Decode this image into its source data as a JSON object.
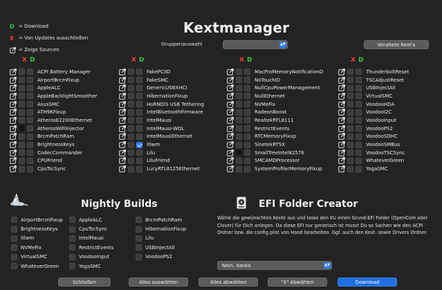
{
  "legend": {
    "download_key": "D",
    "download_text": "= Download",
    "exclude_key": "X",
    "exclude_text": "= Von Updates ausschließen",
    "source_text": "= Zeige Sourcen",
    "source_icon": "edit-external-icon"
  },
  "title": "Kextmanager",
  "group": {
    "label": "Gruppenauswahl",
    "value": ""
  },
  "outdated_button": "Veraltete Kext's",
  "column_header": {
    "x": "X",
    "d": "D"
  },
  "columns": [
    {
      "items": [
        {
          "name": "ACPI Battery Manager",
          "d": false,
          "dark": false
        },
        {
          "name": "AirportBrcmFixup",
          "d": false,
          "dark": false
        },
        {
          "name": "AppleALC",
          "d": false,
          "dark": false
        },
        {
          "name": "AppleBacklightSmoother",
          "d": false,
          "dark": false
        },
        {
          "name": "AsusSMC",
          "d": false,
          "dark": false
        },
        {
          "name": "ATH9KFixup",
          "d": false,
          "dark": false
        },
        {
          "name": "AtherosE2200Ethernet",
          "d": false,
          "dark": false
        },
        {
          "name": "AtherosWiFiInjector",
          "d": false,
          "dark": true
        },
        {
          "name": "BrcmPatchRam",
          "d": false,
          "dark": false
        },
        {
          "name": "BrightnessKeys",
          "d": false,
          "dark": false
        },
        {
          "name": "CodecCommander",
          "d": false,
          "dark": false
        },
        {
          "name": "CPUFriend",
          "d": false,
          "dark": false
        },
        {
          "name": "CpuTscSync",
          "d": false,
          "dark": false
        }
      ]
    },
    {
      "items": [
        {
          "name": "FakePCIID",
          "d": false,
          "dark": false
        },
        {
          "name": "FakeSMC",
          "d": false,
          "dark": false
        },
        {
          "name": "GenericUSBXHCI",
          "d": false,
          "dark": false
        },
        {
          "name": "HibernationFixup",
          "d": false,
          "dark": false
        },
        {
          "name": "HoRNDIS USB Tethering",
          "d": false,
          "dark": false
        },
        {
          "name": "IntelBluetoothFirmware",
          "d": false,
          "dark": false
        },
        {
          "name": "IntelMausi",
          "d": false,
          "dark": false
        },
        {
          "name": "IntelMausi-WOL",
          "d": false,
          "dark": false
        },
        {
          "name": "IntelMausiEthernet",
          "d": false,
          "dark": false
        },
        {
          "name": "itlwm",
          "d": true,
          "dark": false
        },
        {
          "name": "Lilu",
          "d": false,
          "dark": false
        },
        {
          "name": "LiluFriend",
          "d": false,
          "dark": false
        },
        {
          "name": "LucyRTL8125Ethernet",
          "d": false,
          "dark": false
        }
      ]
    },
    {
      "items": [
        {
          "name": "MacProMemoryNotificationD",
          "d": false,
          "dark": false
        },
        {
          "name": "NoTouchID",
          "d": false,
          "dark": false
        },
        {
          "name": "NullCpuPowerManagement",
          "d": false,
          "dark": false
        },
        {
          "name": "NullEthernet",
          "d": false,
          "dark": false
        },
        {
          "name": "NVMeFix",
          "d": false,
          "dark": false
        },
        {
          "name": "RadeonBoost",
          "d": false,
          "dark": false
        },
        {
          "name": "RealtekRTL8111",
          "d": false,
          "dark": false
        },
        {
          "name": "RestrictEvents",
          "d": false,
          "dark": false
        },
        {
          "name": "RTCMemoryFixup",
          "d": false,
          "dark": false
        },
        {
          "name": "SinetekRTSX",
          "d": false,
          "dark": false
        },
        {
          "name": "SmallTreeIntel82576",
          "d": false,
          "dark": true
        },
        {
          "name": "SMCAMDProcessor",
          "d": false,
          "dark": false
        },
        {
          "name": "SystemProfilerMemoryFixup",
          "d": false,
          "dark": false
        }
      ]
    },
    {
      "items": [
        {
          "name": "ThunderboltReset",
          "d": false,
          "dark": false
        },
        {
          "name": "TSCAdjustReset",
          "d": false,
          "dark": false
        },
        {
          "name": "USBInjectAll",
          "d": false,
          "dark": false
        },
        {
          "name": "VirtualSMC",
          "d": false,
          "dark": false
        },
        {
          "name": "VoodooHDA",
          "d": false,
          "dark": false
        },
        {
          "name": "VoodooI2C",
          "d": false,
          "dark": false
        },
        {
          "name": "VoodooInput",
          "d": false,
          "dark": false
        },
        {
          "name": "VoodooPS2",
          "d": false,
          "dark": false
        },
        {
          "name": "VoodooSDHC",
          "d": false,
          "dark": false
        },
        {
          "name": "VoodooSMBus",
          "d": false,
          "dark": false
        },
        {
          "name": "VoodooTSCSync",
          "d": false,
          "dark": false
        },
        {
          "name": "WhateverGreen",
          "d": false,
          "dark": false
        },
        {
          "name": "YogaSMC",
          "d": false,
          "dark": false
        }
      ]
    }
  ],
  "nightly": {
    "title": "Nightly Builds",
    "icon": "wizard-hat-icon",
    "columns": [
      [
        "AirportBrcmFixup",
        "BrightnessKeys",
        "itlwm",
        "NVMeFix",
        "VirtualSMC",
        "WhateverGreen"
      ],
      [
        "AppleALC",
        "CpuTscSync",
        "IntelMausi",
        "RestrictEvents",
        "VoodooInput",
        "YogaSMC"
      ],
      [
        "BrcmPatchRam",
        "HibernationFixup",
        "Lilu",
        "USBInjectAll",
        "VoodooPS2"
      ]
    ]
  },
  "efi": {
    "title": "EFI Folder Creator",
    "icon": "drive-icon",
    "description": "Wähle die gewünschten Kexte aus und lasse den KU einen Grund-EFI Folder (OpenCore oder Clover) für Dich anlegen. Da diese EFI nur generisch ist musst Du so Sachen wie den ACPI Ordner bzw. die config.plist von Hand bearbeiten. Ggf. auch den Kext- sowie Drivers Ordner.",
    "select_value": "Nein, danke"
  },
  "buttons": {
    "close": "Schließen",
    "select_all": "Alles auswählen",
    "deselect_all": "Alles abwählen",
    "deselect_x": "\"X\" Abwählen",
    "download": "Download"
  },
  "colors": {
    "accent": "#2f7ff0",
    "download_green": "#2ecc40",
    "exclude_red": "#ff3b30",
    "background": "#232323"
  }
}
